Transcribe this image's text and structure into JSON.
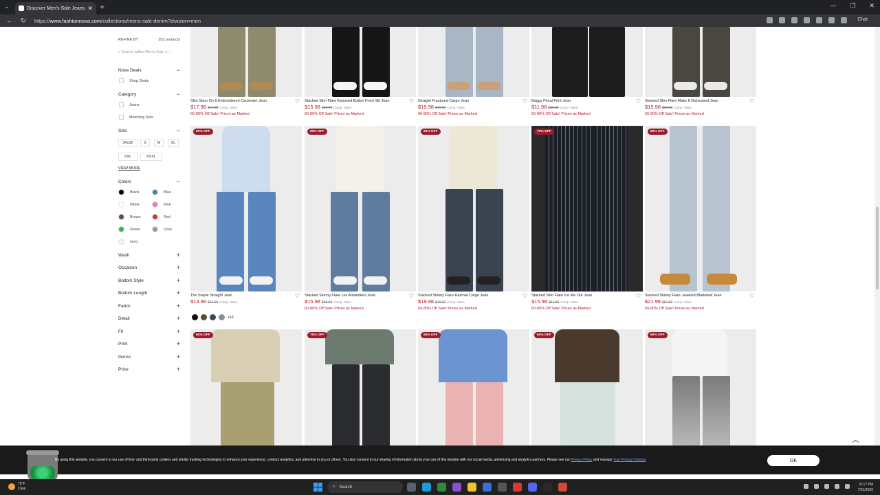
{
  "browser": {
    "tab_title": "Discover Men's Sale Jeans | Fashion",
    "url_prefix": "https://",
    "url_domain": "www.fashionnova.com",
    "url_path": "/collections/mens-sale-denim?division=men",
    "chat_label": "Chat"
  },
  "sidebar": {
    "refine_label": "REFINE BY",
    "product_count": "353 products",
    "search_placeholder": "Search within Men's Sale J...",
    "nova_deals": {
      "label": "Nova Deals",
      "items": [
        "Shop Deals"
      ]
    },
    "category": {
      "label": "Category",
      "items": [
        "Jeans",
        "Matching Sets"
      ]
    },
    "size": {
      "label": "Size",
      "options": [
        "34x32",
        "S",
        "M",
        "XL",
        "XXL",
        "XXXL"
      ],
      "view_more": "VIEW MORE"
    },
    "colors": {
      "label": "Colors",
      "items": [
        {
          "name": "Black",
          "hex": "#000000"
        },
        {
          "name": "Blue",
          "hex": "#4a7fb0"
        },
        {
          "name": "White",
          "hex": "#ffffff"
        },
        {
          "name": "Pink",
          "hex": "#e07fc0"
        },
        {
          "name": "Brown",
          "hex": "#6b4a3a"
        },
        {
          "name": "Red",
          "hex": "#cc3a3a"
        },
        {
          "name": "Green",
          "hex": "#3cb44a"
        },
        {
          "name": "Grey",
          "hex": "#9a9a9a"
        },
        {
          "name": "Ivory",
          "hex": "#f6f3e6"
        }
      ]
    },
    "collapsed_sections": [
      "Wash",
      "Occasion",
      "Bottom Style",
      "Bottom Length",
      "Fabric",
      "Detail",
      "Fit",
      "Print",
      "Genre",
      "Price"
    ]
  },
  "products_row1": [
    {
      "name": "Slim Stars On It Embroidered Carpenter Jean",
      "price": "$17.98",
      "was": "$44.99",
      "comp": "Comp. Value",
      "sale": "60-80% Off Sale! Prices as Marked"
    },
    {
      "name": "Stacked Slim Flare Exposed Button Front Slit Jean",
      "price": "$15.98",
      "was": "$39.99",
      "comp": "Comp. Value",
      "sale": "60-80% Off Sale! Prices as Marked"
    },
    {
      "name": "Straight Fractured Cargo Jean",
      "price": "$19.98",
      "was": "$49.99",
      "comp": "Comp. Value",
      "sale": "60-80% Off Sale! Prices as Marked"
    },
    {
      "name": "Baggy Floral Print Jean",
      "price": "$11.98",
      "was": "$39.99",
      "comp": "Comp. Value",
      "sale": "60-80% Off Sale! Prices as Marked"
    },
    {
      "name": "Stacked Slim Flare Make It Distressed Jean",
      "price": "$15.98",
      "was": "$39.99",
      "comp": "Comp. Value",
      "sale": "60-80% Off Sale! Prices as Marked"
    }
  ],
  "products_row2": [
    {
      "badge": "60% OFF",
      "name": "The Staple Straight Jean",
      "price": "$13.98",
      "was": "$34.99",
      "comp": "Comp. Value",
      "sale": "60-80% Off Sale! Prices as Marked"
    },
    {
      "badge": "60% OFF",
      "name": "Stacked Skinny Flare Les Amandiers Jean",
      "price": "$15.98",
      "was": "$39.99",
      "comp": "Comp. Value",
      "sale": "60-80% Off Sale! Prices as Marked"
    },
    {
      "badge": "60% OFF",
      "name": "Stacked Skinny Flare Hazmat Cargo Jean",
      "price": "$19.98",
      "was": "$49.99",
      "comp": "Comp. Value",
      "sale": "60-80% Off Sale! Prices as Marked"
    },
    {
      "badge": "70% OFF",
      "name": "Stacked Slim Flare Ice Me Out Jean",
      "price": "$15.98",
      "was": "$54.99",
      "comp": "Comp. Value",
      "sale": "60-80% Off Sale! Prices as Marked"
    },
    {
      "badge": "60% OFF",
      "name": "Stacked Skinny Flare Jeweled Bladeleaf Jean",
      "price": "$21.98",
      "was": "$54.99",
      "comp": "Comp. Value",
      "sale": "60-80% Off Sale! Prices as Marked"
    }
  ],
  "row2_swatch_more": "+10",
  "products_row3": [
    {
      "badge": "60% OFF"
    },
    {
      "badge": "70% OFF"
    },
    {
      "badge": "60% OFF"
    },
    {
      "badge": "60% OFF"
    },
    {
      "badge": "60% OFF"
    }
  ],
  "cookie": {
    "text": "By using this website, you consent to our use of first- and third-party cookies and similar tracking technologies to enhance your experience, conduct analytics, and advertise to you or others. You also consent to our sharing of information about your use of this website with our social media, advertising and analytics partners. Please see our",
    "privacy_link": "Privacy Policy",
    "middle": "and manage",
    "choices_link": "Your Privacy Choices",
    "ok": "OK"
  },
  "taskbar": {
    "temp": "75°F",
    "weather": "Clear",
    "search": "Search",
    "time": "10:17 PM",
    "date": "7/31/2026"
  }
}
